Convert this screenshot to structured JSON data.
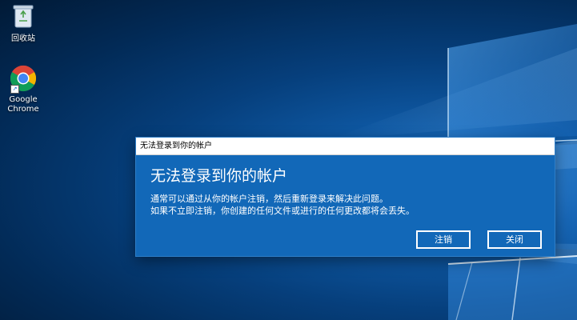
{
  "desktop": {
    "icons": [
      {
        "label": "回收站",
        "icon": "recycle-bin-icon"
      },
      {
        "label": "Google\nChrome",
        "label_line1": "Google",
        "label_line2": "Chrome",
        "icon": "chrome-icon"
      }
    ]
  },
  "dialog": {
    "window_title": "无法登录到你的帐户",
    "heading": "无法登录到你的帐户",
    "message_line1": "通常可以通过从你的帐户注销，然后重新登录来解决此问题。",
    "message_line2": "如果不立即注销，你创建的任何文件或进行的任何更改都将会丢失。",
    "buttons": {
      "sign_out": "注销",
      "close": "关闭"
    },
    "accent_color": "#1268b8"
  }
}
